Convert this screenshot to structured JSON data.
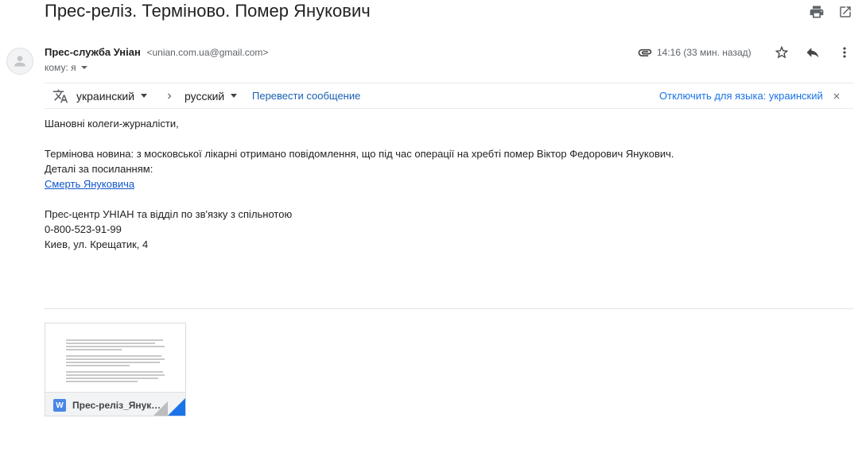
{
  "email": {
    "subject": "Прес-реліз. Терміново. Помер Янукович",
    "sender_name": "Прес-служба Уніан",
    "sender_email": "<unian.com.ua@gmail.com>",
    "to_label": "кому: я",
    "time": "14:16 (33 мин. назад)"
  },
  "translate": {
    "source_lang": "украинский",
    "target_lang": "русский",
    "translate_link": "Перевести сообщение",
    "disable_link": "Отключить для языка: украинский"
  },
  "body": {
    "greeting": "Шановні колеги-журналісти,",
    "paragraph1": "Термінова новина: з московської лікарні отримано повідомлення, що під час операції на хребті помер Віктор Федорович Янукович.",
    "details_label": "Деталі за посиланням:",
    "link_text": "Смерть Януковича",
    "sig_line1": "Прес-центр УНІАН та відділ по зв'язку з спільнотою",
    "sig_line2": "0-800-523-91-99",
    "sig_line3": "Киев, ул. Крещатик, 4"
  },
  "attachment": {
    "file_name": "Прес-реліз_Янукович.docx",
    "type_icon": "W"
  },
  "icons": {
    "print": "print-icon",
    "open_new": "open-in-new-window-icon",
    "attachment": "paperclip-icon",
    "star": "star-icon",
    "reply": "reply-icon",
    "more": "more-vertical-icon",
    "translate": "translate-icon",
    "arrow": "chevron-right-icon",
    "close": "close-icon"
  }
}
